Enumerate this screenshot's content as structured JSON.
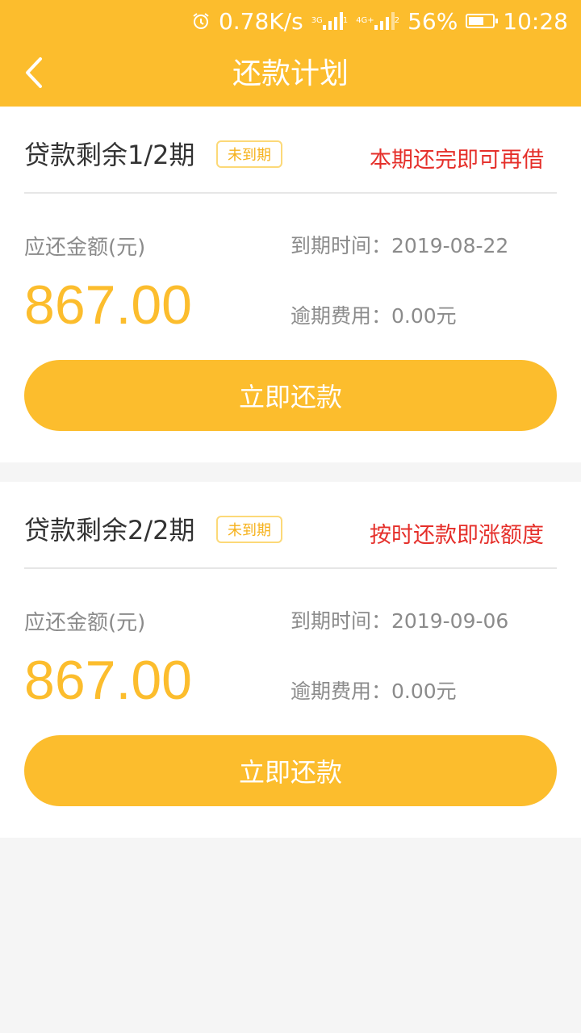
{
  "status_bar": {
    "network_speed": "0.78K/s",
    "sim1_type": "3G",
    "sim1_index": "1",
    "sim2_type": "4G+",
    "sim2_index": "2",
    "battery": "56%",
    "time": "10:28"
  },
  "header": {
    "title": "还款计划",
    "back_icon": "chevron-left-icon"
  },
  "colors": {
    "brand_yellow": "#fcbd2d",
    "alert_red": "#e52f2a",
    "muted_text": "#8b8b8b"
  },
  "plans": [
    {
      "title": "贷款剩余1/2期",
      "badge": "未到期",
      "note": "本期还完即可再借",
      "amount_label": "应还金额(元)",
      "amount": "867.00",
      "due_label": "到期时间：",
      "due_date": "2019-08-22",
      "fee_label": "逾期费用：",
      "fee": "0.00元",
      "button": "立即还款"
    },
    {
      "title": "贷款剩余2/2期",
      "badge": "未到期",
      "note": "按时还款即涨额度",
      "amount_label": "应还金额(元)",
      "amount": "867.00",
      "due_label": "到期时间：",
      "due_date": "2019-09-06",
      "fee_label": "逾期费用：",
      "fee": "0.00元",
      "button": "立即还款"
    }
  ]
}
